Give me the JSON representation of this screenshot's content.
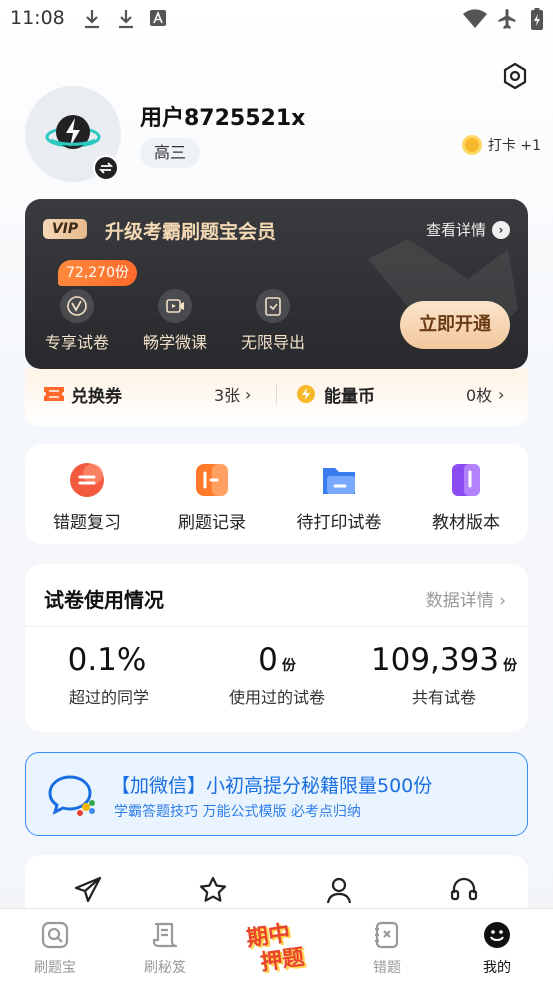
{
  "status_bar": {
    "time": "11:08"
  },
  "profile": {
    "username": "用户8725521x",
    "grade": "高三",
    "checkin_label": "打卡 +1"
  },
  "vip": {
    "badge": "VIP",
    "title": "升级考霸刷题宝会员",
    "detail_label": "查看详情",
    "price_tag": "72,270份",
    "features": [
      "专享试卷",
      "畅学微课",
      "无限导出"
    ],
    "open_button": "立即开通"
  },
  "vouchers": {
    "coupon_label": "兑换券",
    "coupon_value": "3张",
    "energy_label": "能量币",
    "energy_value": "0枚"
  },
  "quick_actions": [
    {
      "label": "错题复习",
      "icon": "wrong-review-icon"
    },
    {
      "label": "刷题记录",
      "icon": "practice-record-icon"
    },
    {
      "label": "待打印试卷",
      "icon": "print-folder-icon"
    },
    {
      "label": "教材版本",
      "icon": "textbook-icon"
    }
  ],
  "usage": {
    "title": "试卷使用情况",
    "detail_link": "数据详情 ›",
    "stats": [
      {
        "value": "0.1%",
        "unit": "",
        "label": "超过的同学"
      },
      {
        "value": "0",
        "unit": "份",
        "label": "使用过的试卷"
      },
      {
        "value": "109,393",
        "unit": "份",
        "label": "共有试卷"
      }
    ]
  },
  "wechat_banner": {
    "title": "【加微信】小初高提分秘籍限量500份",
    "subtitle": "学霸答题技巧 万能公式模版 必考点归纳"
  },
  "tabbar": {
    "tabs": [
      "刷题宝",
      "刷秘笈",
      "错题",
      "我的"
    ],
    "center_label_line1": "期中",
    "center_label_line2": "押题"
  },
  "colors": {
    "accent_blue": "#1a6fe0",
    "vip_gold": "#f3d8b4",
    "orange": "#ff6a2a"
  }
}
